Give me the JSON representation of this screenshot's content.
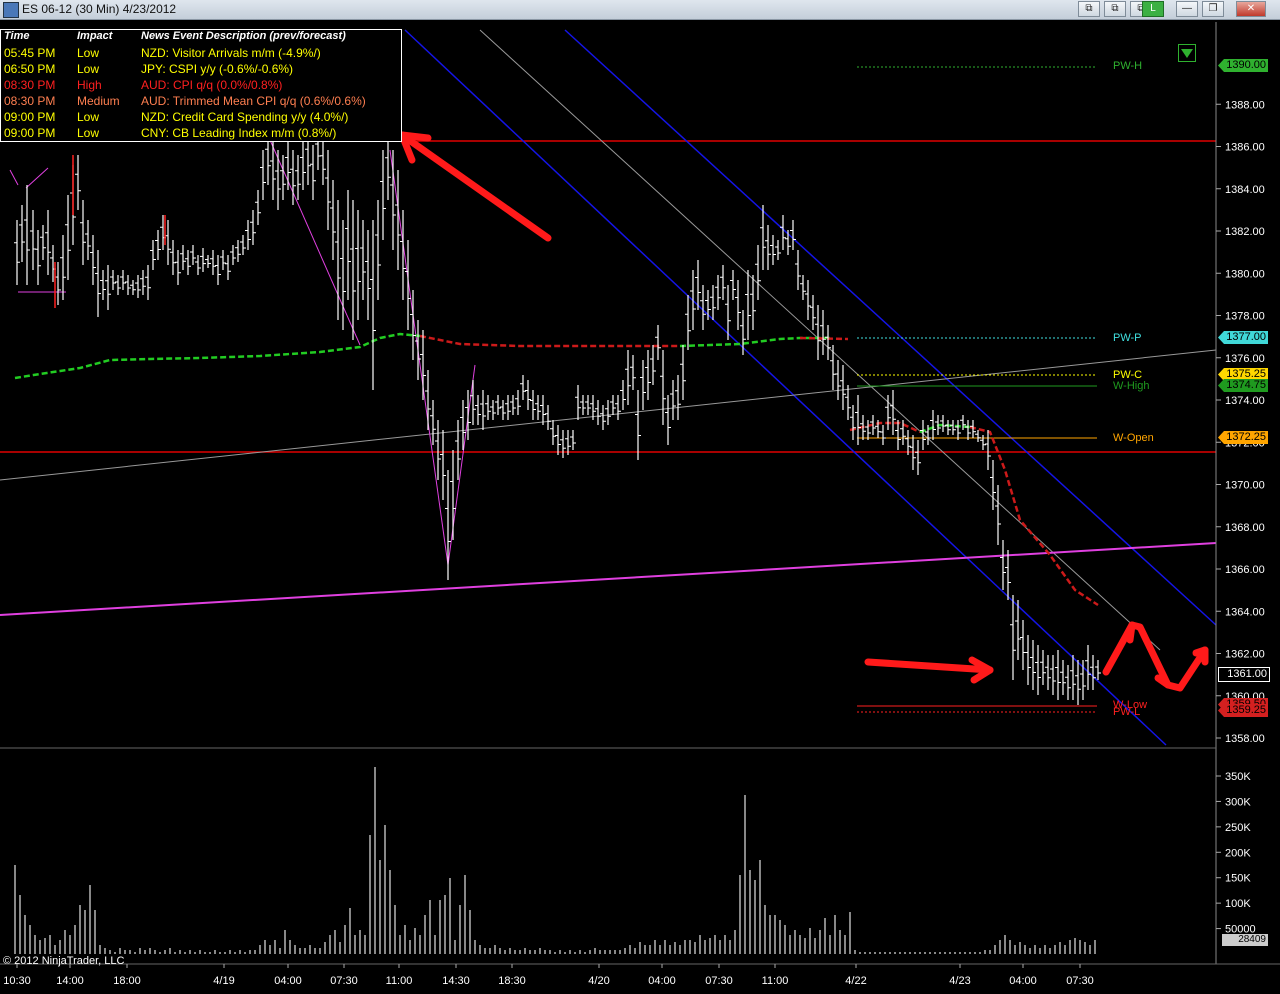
{
  "window": {
    "title": "ES 06-12 (30 Min)  4/23/2012",
    "buttons": [
      "⧉",
      "⧉",
      "⧉",
      "L",
      "—",
      "❐",
      "✕"
    ]
  },
  "news": {
    "headers": [
      "Time",
      "Impact",
      "News Event Description (prev/forecast)"
    ],
    "rows": [
      {
        "time": "05:45 PM",
        "impact": "Low",
        "desc": "NZD: Visitor Arrivals m/m (-4.9%/)",
        "color": "#ffff00"
      },
      {
        "time": "06:50 PM",
        "impact": "Low",
        "desc": "JPY: CSPI y/y (-0.6%/-0.6%)",
        "color": "#ffff00"
      },
      {
        "time": "08:30 PM",
        "impact": "High",
        "desc": "AUD: CPI q/q (0.0%/0.8%)",
        "color": "#ff2020"
      },
      {
        "time": "08:30 PM",
        "impact": "Medium",
        "desc": "AUD: Trimmed Mean CPI q/q (0.6%/0.6%)",
        "color": "#ff7f50"
      },
      {
        "time": "09:00 PM",
        "impact": "Low",
        "desc": "NZD: Credit Card Spending y/y (4.0%/)",
        "color": "#ffff00"
      },
      {
        "time": "09:00 PM",
        "impact": "Low",
        "desc": "CNY: CB Leading Index m/m (0.8%/)",
        "color": "#ffff00"
      }
    ]
  },
  "levels": {
    "pw_h": {
      "label": "PW-H",
      "price": "1390.00",
      "color": "#2fb12f"
    },
    "pw_p": {
      "label": "PW-P",
      "price": "1377.00",
      "color": "#40e0e0"
    },
    "pw_c": {
      "label": "PW-C",
      "price": "1375.25",
      "color": "#ffff00"
    },
    "w_high": {
      "label": "W-High",
      "price": "1374.75",
      "color": "#1f9a1f"
    },
    "w_open": {
      "label": "W-Open",
      "price": "1372.25",
      "color": "#ffa500"
    },
    "w_low": {
      "label": "W-Low",
      "price": "1359.50",
      "color": "#ff2020"
    },
    "pw_l": {
      "label": "PW-L",
      "price": "1359.25",
      "color": "#ff2020"
    },
    "last": {
      "price": "1361.00"
    }
  },
  "price_axis": [
    "1388.00",
    "1386.00",
    "1384.00",
    "1382.00",
    "1380.00",
    "1378.00",
    "1376.00",
    "1374.00",
    "1372.00",
    "1370.00",
    "1368.00",
    "1366.00",
    "1364.00",
    "1362.00",
    "1360.00",
    "1358.00"
  ],
  "volume_axis": [
    "350K",
    "300K",
    "250K",
    "200K",
    "150K",
    "100K",
    "50000"
  ],
  "volume_last": "28409",
  "time_axis": [
    "10:30",
    "14:00",
    "18:00",
    "4/19",
    "04:00",
    "07:30",
    "11:00",
    "14:30",
    "18:30",
    "4/20",
    "04:00",
    "07:30",
    "11:00",
    "4/22",
    "4/23",
    "04:00",
    "07:30"
  ],
  "copyright": "© 2012 NinjaTrader, LLC",
  "colors": {
    "background": "#000000",
    "bar": "#ffffff",
    "channel": "#1414e6",
    "support": "#e00000",
    "magenta": "#e040e0",
    "arrow": "#ff1a1a"
  }
}
